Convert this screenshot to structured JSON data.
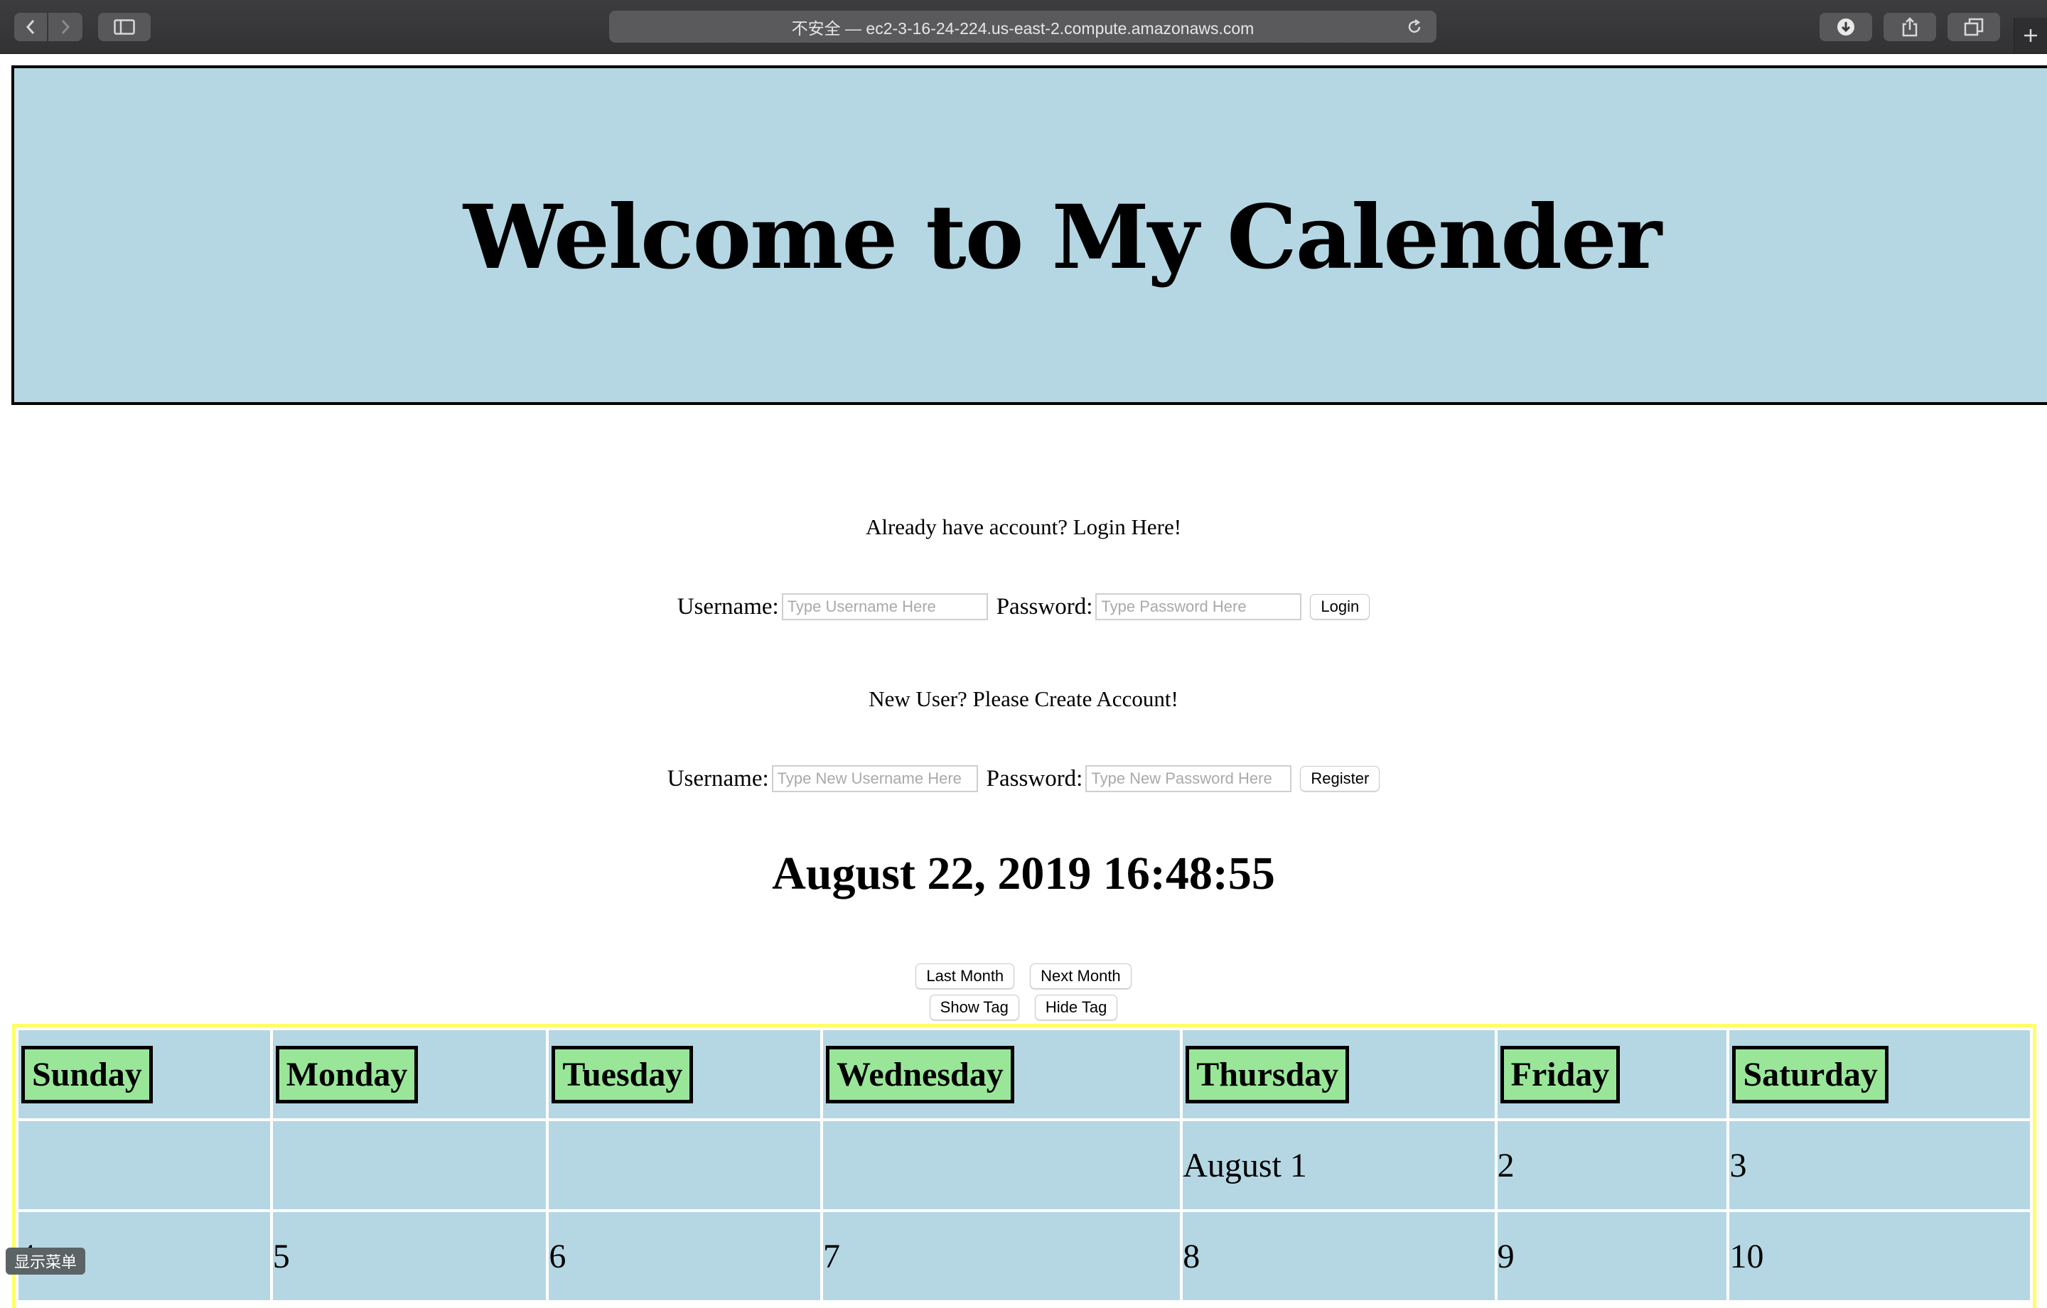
{
  "browser": {
    "address": "不安全 — ec2-3-16-24-224.us-east-2.compute.amazonaws.com"
  },
  "banner": {
    "title": "Welcome to My Calender"
  },
  "login": {
    "prompt": "Already have account? Login Here!",
    "username_label": "Username:",
    "username_placeholder": "Type Username Here",
    "password_label": "Password:",
    "password_placeholder": "Type Password Here",
    "button": "Login"
  },
  "register": {
    "prompt": "New User? Please Create Account!",
    "username_label": "Username:",
    "username_placeholder": "Type New Username Here",
    "password_label": "Password:",
    "password_placeholder": "Type New Password Here",
    "button": "Register"
  },
  "clock": "August 22, 2019 16:48:55",
  "nav": {
    "last_month": "Last Month",
    "next_month": "Next Month",
    "show_tag": "Show Tag",
    "hide_tag": "Hide Tag"
  },
  "calendar": {
    "days": [
      "Sunday",
      "Monday",
      "Tuesday",
      "Wednesday",
      "Thursday",
      "Friday",
      "Saturday"
    ],
    "week1": [
      "",
      "",
      "",
      "",
      "August 1",
      "2",
      "3"
    ],
    "week2": [
      "4",
      "5",
      "6",
      "7",
      "8",
      "9",
      "10"
    ]
  },
  "overlay": {
    "menu": "显示菜单"
  },
  "colors": {
    "banner_bg": "#b5d7e3",
    "dayhead_bg": "#99e699",
    "calendar_border": "#ffff66"
  }
}
